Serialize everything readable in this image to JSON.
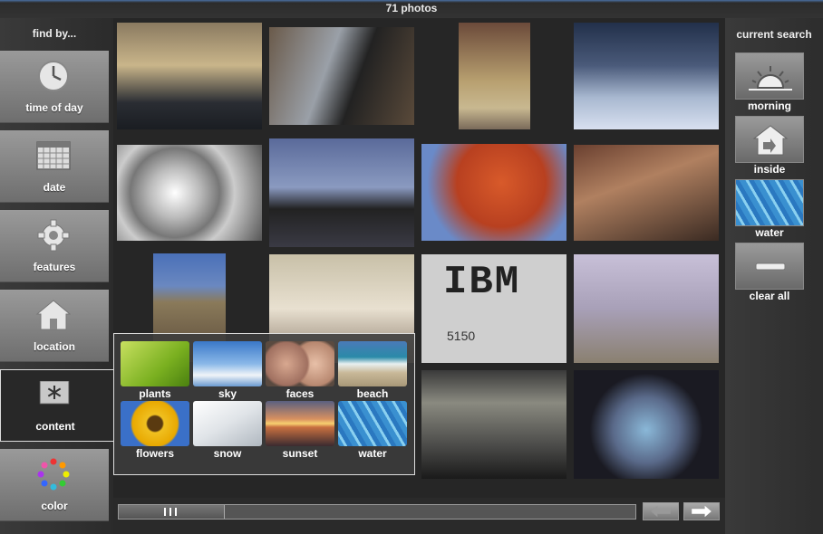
{
  "header": {
    "title": "71 photos"
  },
  "sidebar": {
    "heading": "find by...",
    "items": [
      {
        "label": "time of day",
        "icon": "clock-icon"
      },
      {
        "label": "date",
        "icon": "calendar-icon"
      },
      {
        "label": "features",
        "icon": "gear-icon"
      },
      {
        "label": "location",
        "icon": "house-icon"
      },
      {
        "label": "content",
        "icon": "asterisk-icon",
        "active": true
      },
      {
        "label": "color",
        "icon": "color-wheel-icon"
      }
    ]
  },
  "content_popup": {
    "options": [
      {
        "label": "plants"
      },
      {
        "label": "sky"
      },
      {
        "label": "faces"
      },
      {
        "label": "beach"
      },
      {
        "label": "flowers"
      },
      {
        "label": "snow"
      },
      {
        "label": "sunset"
      },
      {
        "label": "water"
      }
    ]
  },
  "grid_image_text": {
    "ibm_sign": "IBM",
    "ibm_number": "5150"
  },
  "current_search": {
    "heading": "current search",
    "items": [
      {
        "label": "morning",
        "icon": "sunrise-icon"
      },
      {
        "label": "inside",
        "icon": "house-arrow-icon"
      },
      {
        "label": "water",
        "icon": "water-thumbnail"
      },
      {
        "label": "clear all",
        "icon": "minus-icon"
      }
    ]
  },
  "colors": {
    "accent_top": "#4a6ea0",
    "panel": "#2a2a2a",
    "button": "#8a8a8a"
  }
}
